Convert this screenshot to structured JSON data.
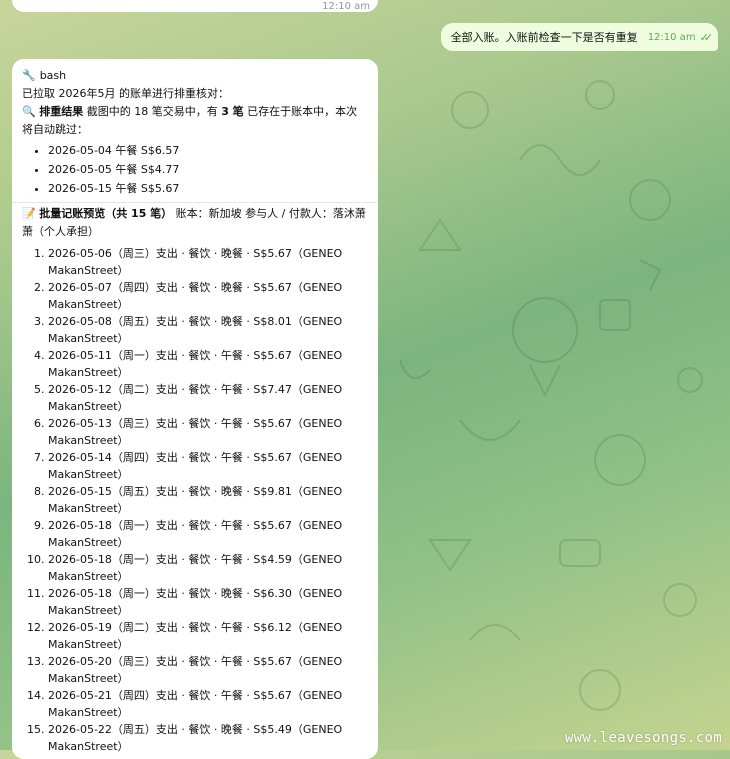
{
  "colors": {
    "outgoing_bubble": "#effdde",
    "incoming_bubble": "#ffffff",
    "check": "#4fae4e"
  },
  "top_bubble": {
    "time": "12:10 am"
  },
  "outgoing": {
    "text": "全部入账。入账前检查一下是否有重复",
    "time": "12:10 am",
    "status_icon": "double-check-icon"
  },
  "incoming": {
    "header": "bash",
    "header_icon": "wrench-icon",
    "intro": "已拉取 2026年5月 的账单进行排重核对：",
    "dedup": {
      "icon": "magnifier-icon",
      "bold": "排重结果",
      "text_a": " 截图中的 18 笔交易中，有 ",
      "count": "3 笔",
      "text_b": " 已存在于账本中，本次将自动跳过："
    },
    "skipped": [
      "2026-05-04 午餐 S$6.57",
      "2026-05-05 午餐 S$4.77",
      "2026-05-15 午餐 S$5.67"
    ],
    "preview": {
      "icon": "memo-icon",
      "bold": "批量记账预览",
      "paren_a": "（共 ",
      "count": "15 笔",
      "paren_b": "）",
      "rest": " 账本：新加坡 参与人 / 付款人：落沐萧萧（个人承担）"
    },
    "items": [
      {
        "line1": "2026-05-06（周三）支出 · 餐饮 · 晚餐 · S$5.67（GENEO",
        "line2": "MakanStreet）"
      },
      {
        "line1": "2026-05-07（周四）支出 · 餐饮 · 晚餐 · S$5.67（GENEO",
        "line2": "MakanStreet）"
      },
      {
        "line1": "2026-05-08（周五）支出 · 餐饮 · 晚餐 · S$8.01（GENEO",
        "line2": "MakanStreet）"
      },
      {
        "line1": "2026-05-11（周一）支出 · 餐饮 · 午餐 · S$5.67（GENEO",
        "line2": "MakanStreet）"
      },
      {
        "line1": "2026-05-12（周二）支出 · 餐饮 · 午餐 · S$7.47（GENEO",
        "line2": "MakanStreet）"
      },
      {
        "line1": "2026-05-13（周三）支出 · 餐饮 · 午餐 · S$5.67（GENEO",
        "line2": "MakanStreet）"
      },
      {
        "line1": "2026-05-14（周四）支出 · 餐饮 · 午餐 · S$5.67（GENEO",
        "line2": "MakanStreet）"
      },
      {
        "line1": "2026-05-15（周五）支出 · 餐饮 · 晚餐 · S$9.81（GENEO",
        "line2": "MakanStreet）"
      },
      {
        "line1": "2026-05-18（周一）支出 · 餐饮 · 午餐 · S$5.67（GENEO",
        "line2": "MakanStreet）"
      },
      {
        "line1": "2026-05-18（周一）支出 · 餐饮 · 午餐 · S$4.59（GENEO",
        "line2": "MakanStreet）"
      },
      {
        "line1": "2026-05-18（周一）支出 · 餐饮 · 晚餐 · S$6.30（GENEO",
        "line2": "MakanStreet）"
      },
      {
        "line1": "2026-05-19（周二）支出 · 餐饮 · 午餐 · S$6.12（GENEO",
        "line2": "MakanStreet）"
      },
      {
        "line1": "2026-05-20（周三）支出 · 餐饮 · 午餐 · S$5.67（GENEO",
        "line2": "MakanStreet）"
      },
      {
        "line1": "2026-05-21（周四）支出 · 餐饮 · 午餐 · S$5.67（GENEO",
        "line2": "MakanStreet）"
      },
      {
        "line1": "2026-05-22（周五）支出 · 餐饮 · 晚餐 · S$5.49（GENEO",
        "line2": "MakanStreet）"
      }
    ]
  },
  "watermark": "www.leavesongs.com"
}
